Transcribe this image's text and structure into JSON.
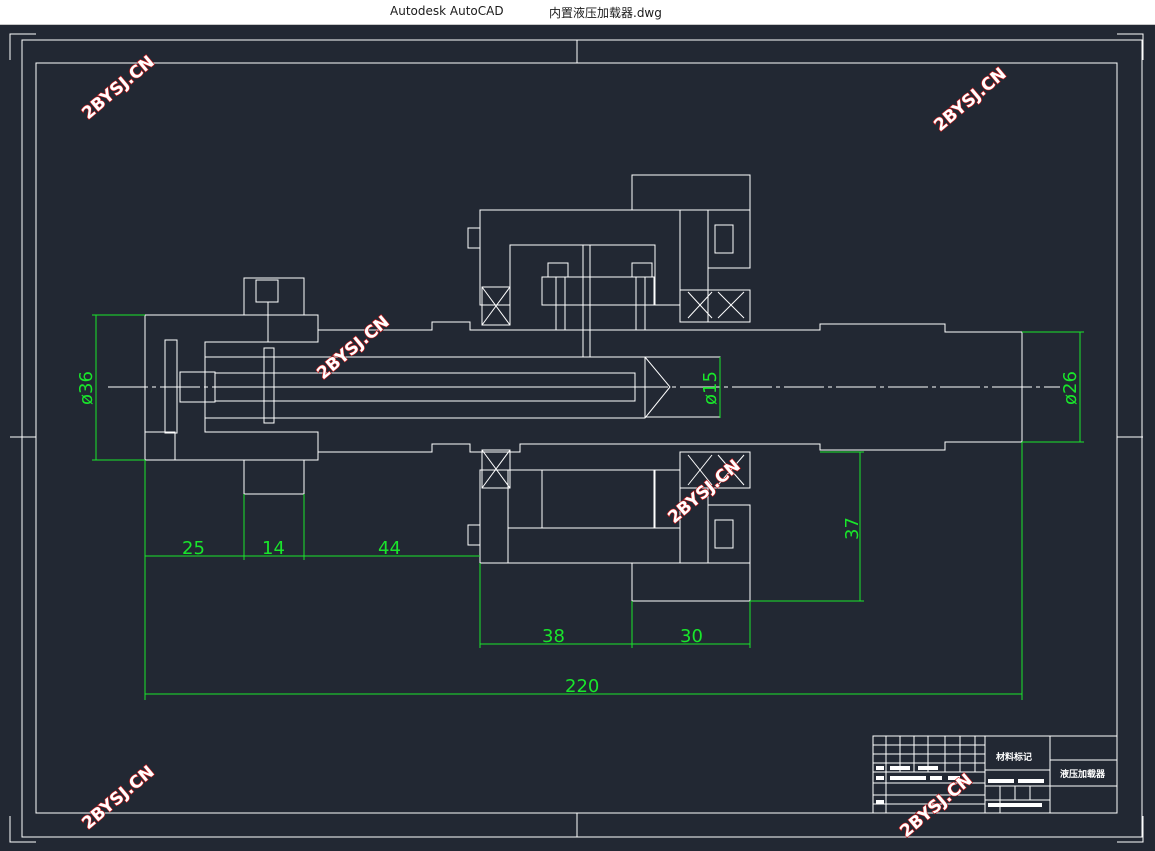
{
  "window": {
    "app_name": "Autodesk AutoCAD",
    "document_name": "内置液压加载器.dwg"
  },
  "drawing": {
    "dimensions": {
      "d36": "ø36",
      "d15": "ø15",
      "d26": "ø26",
      "len25": "25",
      "len14": "14",
      "len44": "44",
      "len38": "38",
      "len30": "30",
      "len37": "37",
      "len220": "220"
    },
    "title_block": {
      "material_mark": "材料标记",
      "drawing_name": "液压加载器"
    },
    "watermark": "2BYSJ.CN"
  },
  "colors": {
    "background": "#222833",
    "lines": "#ffffff",
    "dimensions": "#19e62b",
    "watermark_outline": "#d11a1a"
  }
}
